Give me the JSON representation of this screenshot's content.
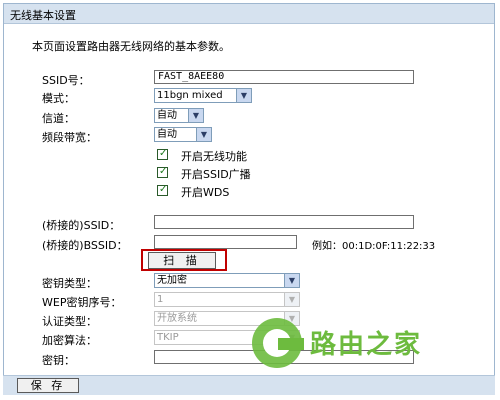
{
  "window": {
    "title": "无线基本设置"
  },
  "description": "本页面设置路由器无线网络的基本参数。",
  "fields": {
    "ssid_label": "SSID号：",
    "ssid_value": "FAST_8AEE80",
    "mode_label": "模式：",
    "mode_value": "11bgn mixed",
    "channel_label": "信道：",
    "channel_value": "自动",
    "bandwidth_label": "频段带宽：",
    "bandwidth_value": "自动"
  },
  "checkboxes": [
    {
      "label": "开启无线功能",
      "checked": true
    },
    {
      "label": "开启SSID广播",
      "checked": true
    },
    {
      "label": "开启WDS",
      "checked": true
    }
  ],
  "wds": {
    "bridged_ssid_label": "(桥接的)SSID：",
    "bridged_ssid_value": "",
    "bridged_bssid_label": "(桥接的)BSSID：",
    "bridged_bssid_value": "",
    "example_text": "例如：00:1D:0F:11:22:33",
    "scan_label": "扫 描"
  },
  "security": {
    "key_type_label": "密钥类型：",
    "key_type_value": "无加密",
    "wep_index_label": "WEP密钥序号：",
    "wep_index_value": "1",
    "auth_type_label": "认证类型：",
    "auth_type_value": "开放系统",
    "cipher_label": "加密算法：",
    "cipher_value": "TKIP",
    "key_label": "密钥：",
    "key_value": ""
  },
  "footer": {
    "save_label": "保 存"
  },
  "watermark": {
    "text": "路由之家"
  },
  "colors": {
    "header_bg": "#d6e2ef",
    "highlight": "#c00000",
    "watermark": "#6dbb3e"
  }
}
